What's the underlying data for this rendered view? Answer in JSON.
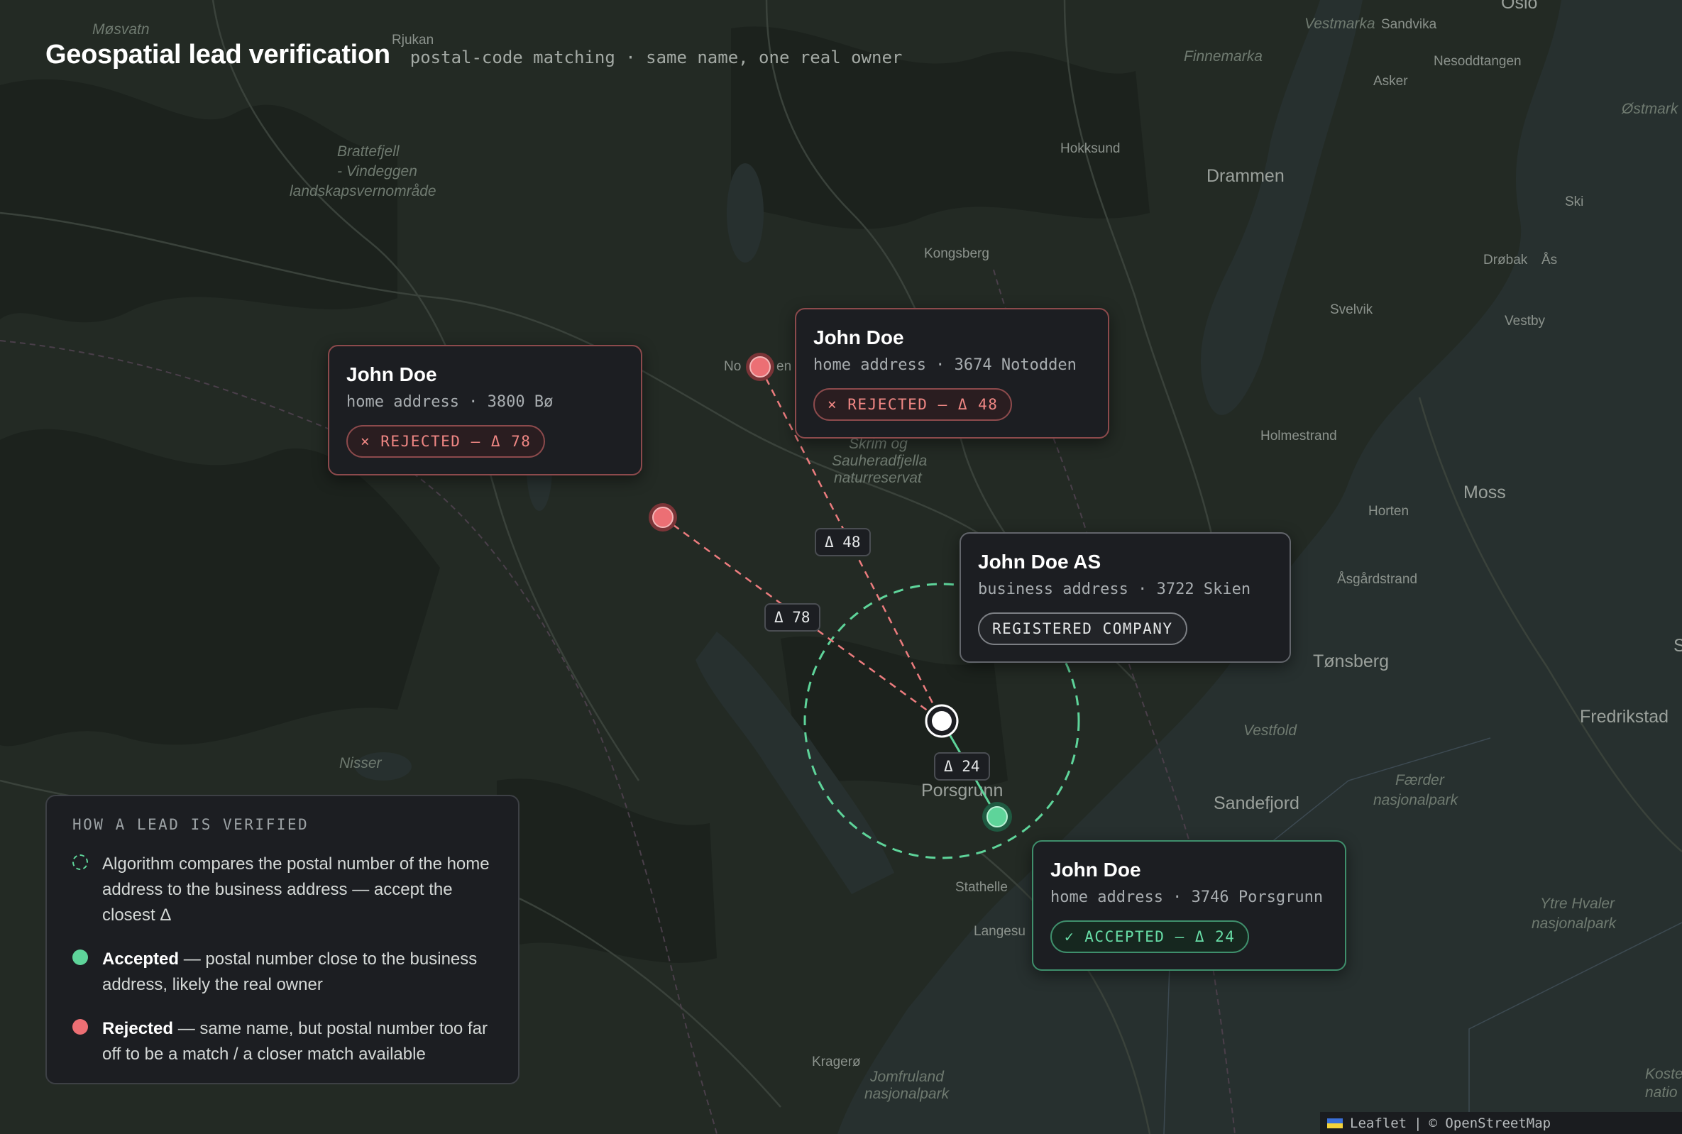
{
  "header": {
    "title": "Geospatial lead verification",
    "subtitle": "postal-code matching · same name, one real owner"
  },
  "map_labels": {
    "mosvatn": "Møsvatn",
    "rjukan": "Rjukan",
    "vestmarka": "Vestmarka",
    "sandvika": "Sandvika",
    "oslo": "Oslo",
    "finnemarka": "Finnemarka",
    "asker": "Asker",
    "nesoddtangen": "Nesoddtangen",
    "ostmark": "Østmark",
    "brattefjell_1": "Brattefjell",
    "brattefjell_2": "- Vindeggen",
    "brattefjell_3": "landskapsvernområde",
    "hokksund": "Hokksund",
    "drammen": "Drammen",
    "ski": "Ski",
    "kongsberg": "Kongsberg",
    "drobak": "Drøbak",
    "as": "Ås",
    "svelvik": "Svelvik",
    "vestby": "Vestby",
    "notodden_a": "No",
    "notodden_b": "en",
    "holmestrand": "Holmestrand",
    "skrim_1": "Skrim og",
    "skrim_2": "Sauheradfjella",
    "skrim_3": "naturreservat",
    "moss": "Moss",
    "horten": "Horten",
    "asgardstrand": "Åsgårdstrand",
    "tonsberg": "Tønsberg",
    "fredrikstad": "Fredrikstad",
    "vestfold": "Vestfold",
    "nisser": "Nisser",
    "faerder_1": "Færder",
    "faerder_2": "nasjonalpark",
    "porsgrunn": "Porsgrunn",
    "sandefjord": "Sandefjord",
    "stathelle": "Stathelle",
    "langesund": "Langesu",
    "ytre_hvaler_1": "Ytre Hvaler",
    "ytre_hvaler_2": "nasjonalpark",
    "kragero": "Kragerø",
    "jomfruland_1": "Jomfruland",
    "jomfruland_2": "nasjonalpark",
    "koste_1": "Koste",
    "koste_2": "natio",
    "edge_s": "S"
  },
  "cards": {
    "bo": {
      "name": "John Doe",
      "address": "home address · 3800 Bø",
      "badge": "× REJECTED — Δ 78"
    },
    "notodden": {
      "name": "John Doe",
      "address": "home address · 3674 Notodden",
      "badge": "× REJECTED — Δ 48"
    },
    "skien": {
      "name": "John Doe AS",
      "address": "business address · 3722 Skien",
      "badge": "REGISTERED COMPANY"
    },
    "porsgrunn": {
      "name": "John Doe",
      "address": "home address · 3746 Porsgrunn",
      "badge": "✓ ACCEPTED — Δ 24"
    }
  },
  "deltas": {
    "notodden": "Δ 48",
    "bo": "Δ 78",
    "porsgrunn": "Δ 24"
  },
  "legend": {
    "heading": "HOW A LEAD IS VERIFIED",
    "algorithm": "Algorithm compares the postal number of the home address to the business address — accept the closest Δ",
    "accepted_title": "Accepted",
    "accepted_text": " — postal number close to the business address, likely the real owner",
    "rejected_title": "Rejected",
    "rejected_text": " — same name, but postal number too far off to be a match / a closer match available"
  },
  "attribution": {
    "leaflet": "Leaflet",
    "separator": "|",
    "osm": "© OpenStreetMap"
  },
  "colors": {
    "accepted": "#5ed49a",
    "rejected": "#ec6f74",
    "business": "#ffffff"
  }
}
